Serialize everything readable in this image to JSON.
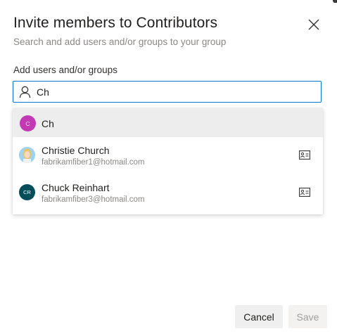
{
  "dialog": {
    "title": "Invite members to Contributors",
    "subtitle": "Search and add users and/or groups to your group",
    "close_icon": "close-icon"
  },
  "search": {
    "label": "Add users and/or groups",
    "value": "Ch",
    "icon": "person-icon"
  },
  "suggestions": [
    {
      "initials": "C",
      "name": "Ch",
      "email": "",
      "avatar_color": "#c239b3"
    },
    {
      "initials": "",
      "name": "Christie Church",
      "email": "fabrikamfiber1@hotmail.com",
      "avatar_color": "#9ed3f2",
      "icon": "contact-card-icon"
    },
    {
      "initials": "CR",
      "name": "Chuck Reinhart",
      "email": "fabrikamfiber3@hotmail.com",
      "avatar_color": "#004e5a",
      "icon": "contact-card-icon"
    }
  ],
  "buttons": {
    "cancel": "Cancel",
    "save": "Save"
  },
  "colors": {
    "accent": "#0078d4",
    "hover_row": "#ededed"
  }
}
